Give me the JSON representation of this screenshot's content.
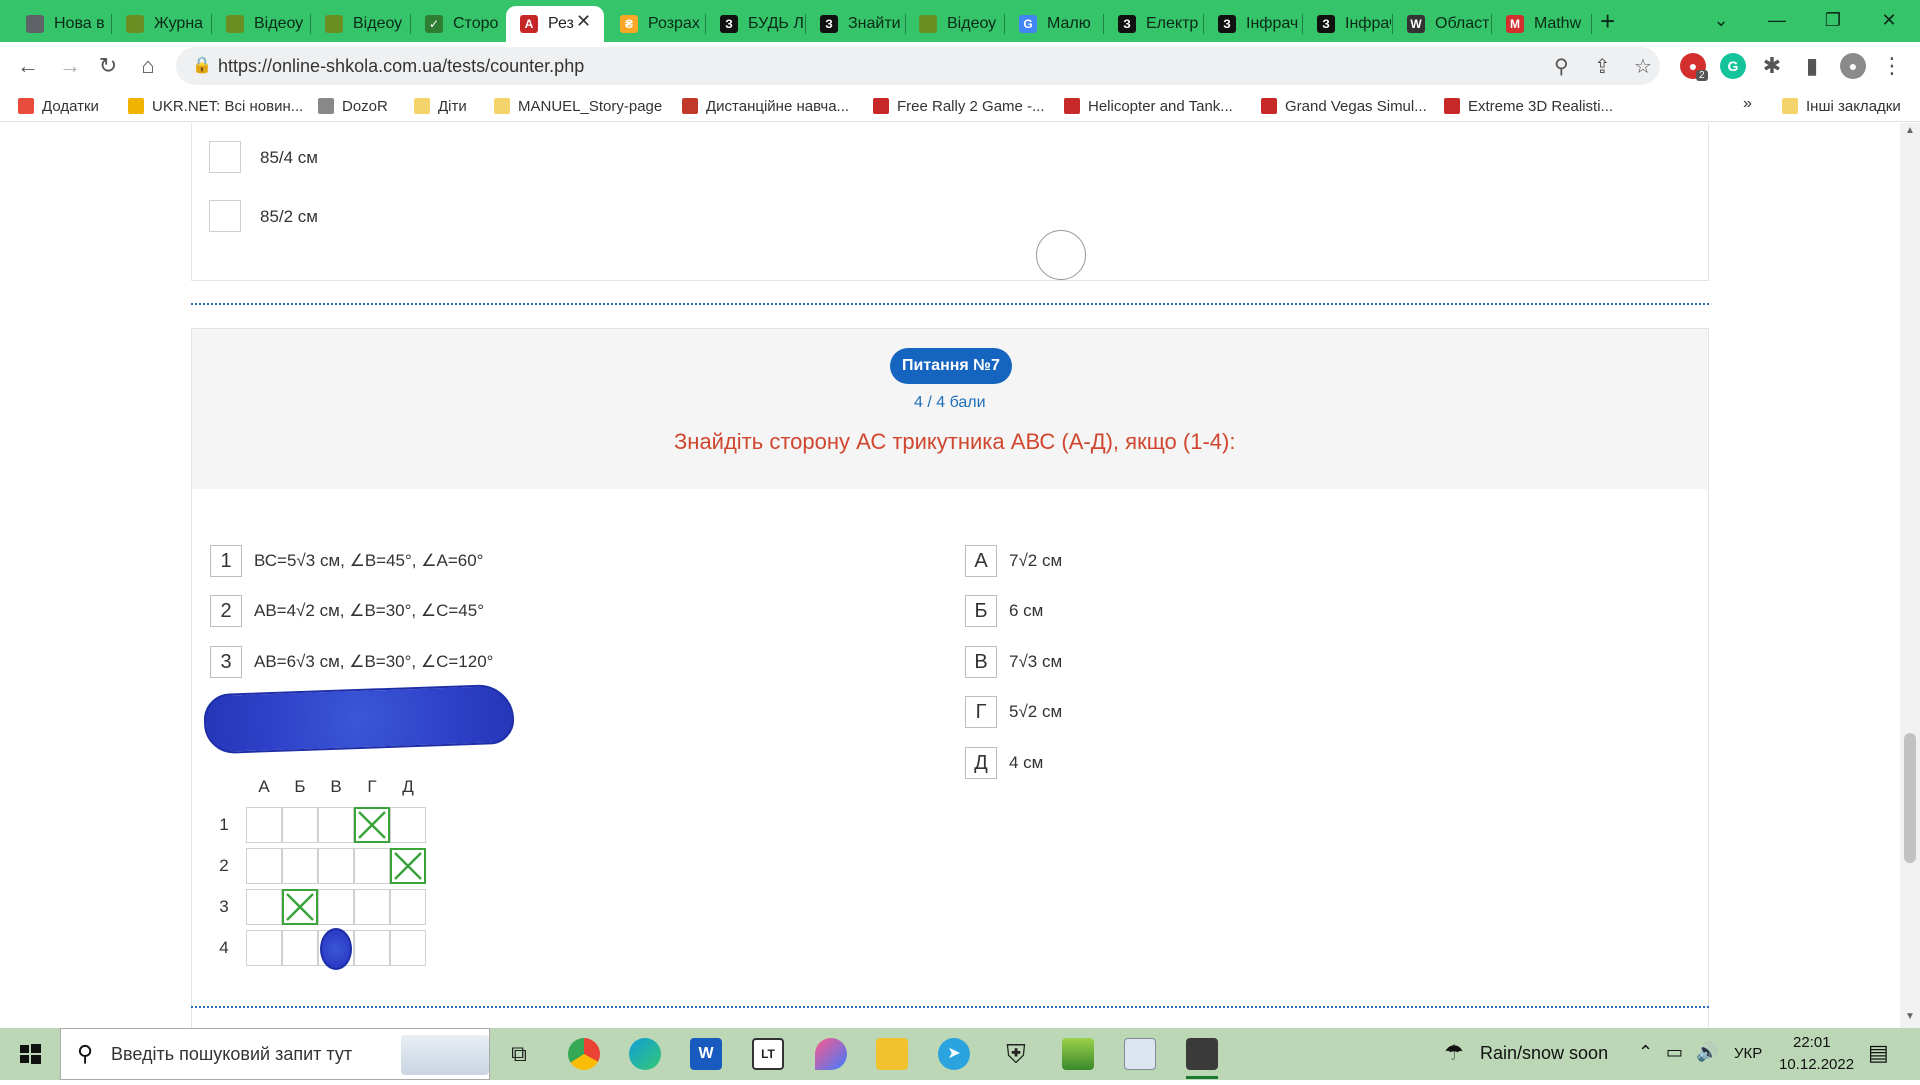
{
  "browser": {
    "tabs": [
      {
        "title": "Нова в",
        "favicon": "chrome-icon",
        "color": "#5f6368",
        "glyph": ""
      },
      {
        "title": "Журна",
        "favicon": "journal-icon",
        "color": "#6b8e23",
        "glyph": ""
      },
      {
        "title": "Відеоу",
        "favicon": "video-icon",
        "color": "#6b8e23",
        "glyph": ""
      },
      {
        "title": "Відеоу",
        "favicon": "video-icon",
        "color": "#6b8e23",
        "glyph": ""
      },
      {
        "title": "Сторо",
        "favicon": "checkmark-icon",
        "color": "#2e7d32",
        "glyph": "✓"
      },
      {
        "title": "Рез",
        "favicon": "test-icon",
        "color": "#c62828",
        "glyph": "A"
      },
      {
        "title": "Розрах",
        "favicon": "calc-icon",
        "color": "#f9a825",
        "glyph": "₴"
      },
      {
        "title": "БУДЬ Л",
        "favicon": "z-icon",
        "color": "#111111",
        "glyph": "З"
      },
      {
        "title": "Знайти",
        "favicon": "z-icon",
        "color": "#111111",
        "glyph": "З"
      },
      {
        "title": "Відеоу",
        "favicon": "video-icon",
        "color": "#6b8e23",
        "glyph": ""
      },
      {
        "title": "Малю",
        "favicon": "google-icon",
        "color": "#4285f4",
        "glyph": "G"
      },
      {
        "title": "Електр",
        "favicon": "z-icon",
        "color": "#111111",
        "glyph": "З"
      },
      {
        "title": "Інфрач",
        "favicon": "z-icon",
        "color": "#111111",
        "glyph": "З"
      },
      {
        "title": "Інфрач",
        "favicon": "z-icon",
        "color": "#111111",
        "glyph": "З"
      },
      {
        "title": "Област",
        "favicon": "wikipedia-icon",
        "color": "#333333",
        "glyph": "W"
      },
      {
        "title": "Mathw",
        "favicon": "mathway-icon",
        "color": "#d32f2f",
        "glyph": "M"
      }
    ],
    "new_tab": "+",
    "url": "https://online-shkola.com.ua/tests/counter.php",
    "bookmarks": [
      {
        "label": "Додатки",
        "icon": "apps-icon"
      },
      {
        "label": "UKR.NET: Всі новин...",
        "icon": "ukrnet-icon"
      },
      {
        "label": "DozoR",
        "icon": "dozor-icon"
      },
      {
        "label": "Діти",
        "icon": "folder-icon"
      },
      {
        "label": "MANUEL_Story-page",
        "icon": "folder-icon"
      },
      {
        "label": "Дистанційне навча...",
        "icon": "school-icon"
      },
      {
        "label": "Free Rally 2 Game -...",
        "icon": "y8-icon"
      },
      {
        "label": "Helicopter and Tank...",
        "icon": "y8-icon"
      },
      {
        "label": "Grand Vegas Simul...",
        "icon": "y8-icon"
      },
      {
        "label": "Extreme 3D Realisti...",
        "icon": "y8-icon"
      }
    ],
    "bookmarks_more": "»",
    "other_bookmarks": "Інші закладки",
    "extension_badge": "2"
  },
  "prev_question": {
    "options": [
      "85/4 см",
      "85/2 см"
    ]
  },
  "question": {
    "badge": "Питання №7",
    "score": "4 / 4 бали",
    "title": "Знайдіть сторону АС трикутника АВС (А-Д), якщо (1-4):",
    "items": [
      {
        "num": "1",
        "text": "ВС=5√3  см, ∠B=45°, ∠A=60°"
      },
      {
        "num": "2",
        "text": "АВ=4√2  см, ∠B=30°, ∠C=45°"
      },
      {
        "num": "3",
        "text": "АВ=6√3  см, ∠B=30°, ∠C=120°"
      }
    ],
    "answers": [
      {
        "letter": "А",
        "text": "7√2 см"
      },
      {
        "letter": "Б",
        "text": "6 см"
      },
      {
        "letter": "В",
        "text": "7√3 см"
      },
      {
        "letter": "Г",
        "text": "5√2 см"
      },
      {
        "letter": "Д",
        "text": "4 см"
      }
    ],
    "grid": {
      "columns": [
        "А",
        "Б",
        "В",
        "Г",
        "Д"
      ],
      "rows": [
        "1",
        "2",
        "3",
        "4"
      ],
      "selected": [
        {
          "row": "1",
          "column": "Г"
        },
        {
          "row": "2",
          "column": "Д"
        },
        {
          "row": "3",
          "column": "Б"
        }
      ]
    }
  },
  "taskbar": {
    "search_placeholder": "Введіть пошуковий запит тут",
    "weather": "Rain/snow soon",
    "language": "УКР",
    "time": "22:01",
    "date": "10.12.2022"
  },
  "colors": {
    "tabbar": "#35c46a",
    "badge": "#1565c0",
    "question_title": "#d0462e",
    "score": "#1f6fb8",
    "check_green": "#3aa33a",
    "scribble_blue": "#2e40c8"
  }
}
